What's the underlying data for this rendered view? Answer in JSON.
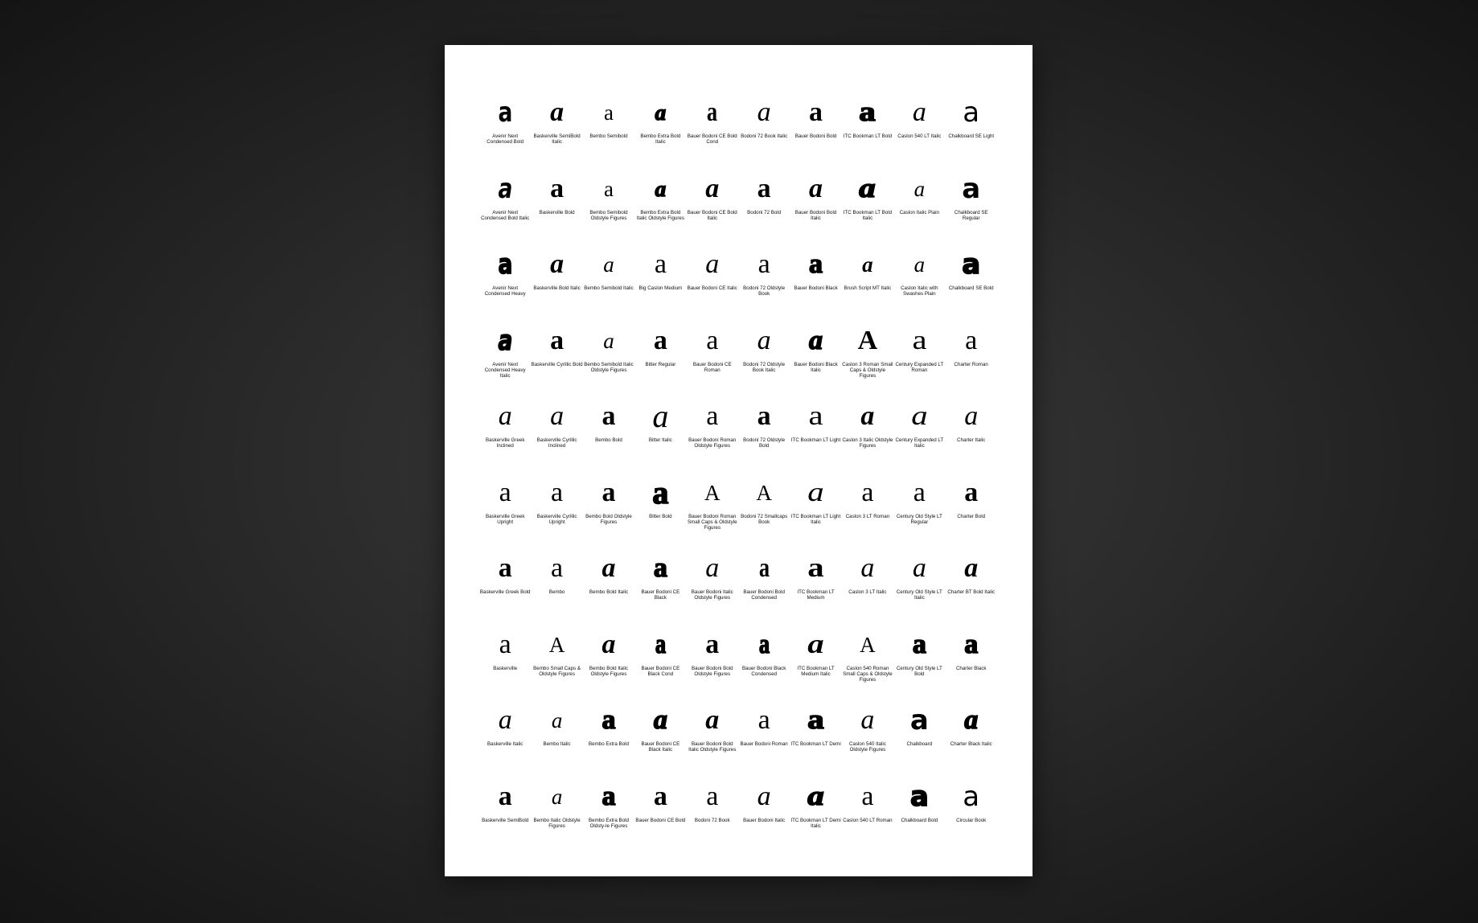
{
  "glyph_char": "a",
  "specimens": [
    {
      "name": "Avenir Next Condensed Bold",
      "glyph": "a",
      "style": "sans b cond"
    },
    {
      "name": "Baskerville SemiBold Italic",
      "glyph": "a",
      "style": "serif b i"
    },
    {
      "name": "Bembo Semibold",
      "glyph": "a",
      "style": "serif small"
    },
    {
      "name": "Bembo Extra Bold Italic",
      "glyph": "a",
      "style": "serif xb i small"
    },
    {
      "name": "Bauer Bodoni CE Bold Cond",
      "glyph": "a",
      "style": "serif b cond"
    },
    {
      "name": "Bodoni 72 Book Italic",
      "glyph": "a",
      "style": "serif i"
    },
    {
      "name": "Bauer Bodoni Bold",
      "glyph": "a",
      "style": "serif b"
    },
    {
      "name": "ITC Bookman LT Bold",
      "glyph": "a",
      "style": "serif xb wide"
    },
    {
      "name": "Caslon 540 LT Italic",
      "glyph": "a",
      "style": "serif i"
    },
    {
      "name": "Chalkboard SE Light",
      "glyph": "a",
      "style": "sans"
    },
    {
      "name": "Avenir Next Condensed Bold Italic",
      "glyph": "a",
      "style": "sans b i cond"
    },
    {
      "name": "Baskerville Bold",
      "glyph": "a",
      "style": "serif b"
    },
    {
      "name": "Bembo Semibold Oldstyle Figures",
      "glyph": "a",
      "style": "serif small"
    },
    {
      "name": "Bembo Extra Bold Italic Oldstyle Figures",
      "glyph": "a",
      "style": "serif xb i small"
    },
    {
      "name": "Bauer Bodoni CE Bold Italic",
      "glyph": "a",
      "style": "serif b i"
    },
    {
      "name": "Bodoni 72 Bold",
      "glyph": "a",
      "style": "serif b"
    },
    {
      "name": "Bauer Bodoni Bold Italic",
      "glyph": "a",
      "style": "serif b i"
    },
    {
      "name": "ITC Bookman LT Bold Italic",
      "glyph": "a",
      "style": "serif xb i wide"
    },
    {
      "name": "Caslon Italic Plain",
      "glyph": "a",
      "style": "serif i small"
    },
    {
      "name": "Chalkboard SE Regular",
      "glyph": "a",
      "style": "sans b"
    },
    {
      "name": "Avenir Next Condensed Heavy",
      "glyph": "a",
      "style": "sans xb cond"
    },
    {
      "name": "Baskerville Bold Italic",
      "glyph": "a",
      "style": "serif b i"
    },
    {
      "name": "Bembo Semibold Italic",
      "glyph": "a",
      "style": "serif i small"
    },
    {
      "name": "Big Caslon Medium",
      "glyph": "a",
      "style": "serif"
    },
    {
      "name": "Bauer Bodoni CE Italic",
      "glyph": "a",
      "style": "serif i"
    },
    {
      "name": "Bodoni 72 Oldstyle Book",
      "glyph": "a",
      "style": "serif"
    },
    {
      "name": "Bauer Bodoni Black",
      "glyph": "a",
      "style": "serif xb"
    },
    {
      "name": "Brush Script MT Italic",
      "glyph": "a",
      "style": "serif b i small"
    },
    {
      "name": "Caslon Italic with Swashes Plain",
      "glyph": "a",
      "style": "serif i small"
    },
    {
      "name": "Chalkboard SE Bold",
      "glyph": "a",
      "style": "sans xb"
    },
    {
      "name": "Avenir Next Condensed Heavy Italic",
      "glyph": "a",
      "style": "sans xb i cond"
    },
    {
      "name": "Baskerville Cyrillic Bold",
      "glyph": "a",
      "style": "serif b"
    },
    {
      "name": "Bembo Semibold Italic Oldstyle Figures",
      "glyph": "a",
      "style": "serif i small"
    },
    {
      "name": "Bitter Regular",
      "glyph": "a",
      "style": "serif b"
    },
    {
      "name": "Bauer Bodoni CE Roman",
      "glyph": "a",
      "style": "serif"
    },
    {
      "name": "Bodoni 72 Oldstyle Book Italic",
      "glyph": "a",
      "style": "serif i"
    },
    {
      "name": "Bauer Bodoni Black Italic",
      "glyph": "a",
      "style": "serif xb i"
    },
    {
      "name": "Caslon 3 Roman Small Caps & Oldstyle Figures",
      "glyph": "A",
      "style": "serif b"
    },
    {
      "name": "Century Expanded LT Roman",
      "glyph": "a",
      "style": "serif wide"
    },
    {
      "name": "Charter Roman",
      "glyph": "a",
      "style": "serif"
    },
    {
      "name": "Baskerville Greek Inclined",
      "glyph": "a",
      "style": "serif i"
    },
    {
      "name": "Baskerville Cyrillic Inclined",
      "glyph": "a",
      "style": "serif i"
    },
    {
      "name": "Bembo Bold",
      "glyph": "a",
      "style": "serif b"
    },
    {
      "name": "Bitter Italic",
      "glyph": "a",
      "style": "serif i big"
    },
    {
      "name": "Bauer Bodoni Roman Oldstyle Figures",
      "glyph": "a",
      "style": "serif"
    },
    {
      "name": "Bodoni 72 Oldstyle Bold",
      "glyph": "a",
      "style": "serif b"
    },
    {
      "name": "ITC Bookman LT Light",
      "glyph": "a",
      "style": "serif wide"
    },
    {
      "name": "Caslon 3 Italic Oldstyle Figures",
      "glyph": "a",
      "style": "serif b i"
    },
    {
      "name": "Century Expanded LT Italic",
      "glyph": "a",
      "style": "serif i wide"
    },
    {
      "name": "Charter Italic",
      "glyph": "a",
      "style": "serif i"
    },
    {
      "name": "Baskerville Greek Upright",
      "glyph": "a",
      "style": "serif"
    },
    {
      "name": "Baskerville Cyrillic Upright",
      "glyph": "a",
      "style": "serif"
    },
    {
      "name": "Bembo Bold Oldstyle Figures",
      "glyph": "a",
      "style": "serif b"
    },
    {
      "name": "Bitter Bold",
      "glyph": "a",
      "style": "serif xb big"
    },
    {
      "name": "Bauer Bodoni Roman Small Caps & Oldstyle Figures",
      "glyph": "A",
      "style": "serif small"
    },
    {
      "name": "Bodoni 72 Smallcaps Book",
      "glyph": "A",
      "style": "serif small"
    },
    {
      "name": "ITC Bookman LT Light Italic",
      "glyph": "a",
      "style": "serif i wide"
    },
    {
      "name": "Caslon 3 LT Roman",
      "glyph": "a",
      "style": "serif"
    },
    {
      "name": "Century Old Style LT Regular",
      "glyph": "a",
      "style": "serif"
    },
    {
      "name": "Charter Bold",
      "glyph": "a",
      "style": "serif b"
    },
    {
      "name": "Baskerville Greek Bold",
      "glyph": "a",
      "style": "serif b"
    },
    {
      "name": "Bembo",
      "glyph": "a",
      "style": "serif"
    },
    {
      "name": "Bembo Bold Italic",
      "glyph": "a",
      "style": "serif b i"
    },
    {
      "name": "Bauer Bodoni CE Black",
      "glyph": "a",
      "style": "serif xb"
    },
    {
      "name": "Bauer Bodoni Italic Oldstyle Figures",
      "glyph": "a",
      "style": "serif i"
    },
    {
      "name": "Bauer Bodoni Bold Condensed",
      "glyph": "a",
      "style": "serif b cond"
    },
    {
      "name": "ITC Bookman LT Medium",
      "glyph": "a",
      "style": "serif b wide"
    },
    {
      "name": "Caslon 3 LT Italic",
      "glyph": "a",
      "style": "serif i"
    },
    {
      "name": "Century Old Style LT Italic",
      "glyph": "a",
      "style": "serif i"
    },
    {
      "name": "Charter BT Bold Italic",
      "glyph": "a",
      "style": "serif b i"
    },
    {
      "name": "Baskerville",
      "glyph": "a",
      "style": "serif"
    },
    {
      "name": "Bembo Small Caps & Oldstyle Figures",
      "glyph": "A",
      "style": "serif small"
    },
    {
      "name": "Bembo Bold Italic Oldstyle Figures",
      "glyph": "a",
      "style": "serif b i"
    },
    {
      "name": "Bauer Bodoni CE Black Cond",
      "glyph": "a",
      "style": "serif xb cond"
    },
    {
      "name": "Bauer Bodoni Bold Oldstyle Figures",
      "glyph": "a",
      "style": "serif b"
    },
    {
      "name": "Bauer Bodoni Black Condensed",
      "glyph": "a",
      "style": "serif xb cond"
    },
    {
      "name": "ITC Bookman LT Medium Italic",
      "glyph": "a",
      "style": "serif b i wide"
    },
    {
      "name": "Caslon 540 Roman Small Caps & Oldstyle Figures",
      "glyph": "A",
      "style": "serif small"
    },
    {
      "name": "Century Old Style LT Bold",
      "glyph": "a",
      "style": "serif xb"
    },
    {
      "name": "Charter Black",
      "glyph": "a",
      "style": "serif xb"
    },
    {
      "name": "Baskerville Italic",
      "glyph": "a",
      "style": "serif i"
    },
    {
      "name": "Bembo Italic",
      "glyph": "a",
      "style": "serif i small"
    },
    {
      "name": "Bembo Extra Bold",
      "glyph": "a",
      "style": "serif xb"
    },
    {
      "name": "Bauer Bodoni CE Black Italic",
      "glyph": "a",
      "style": "serif xb i"
    },
    {
      "name": "Bauer Bodoni Bold Italic Oldstyle Figures",
      "glyph": "a",
      "style": "serif b i"
    },
    {
      "name": "Bauer Bodoni Roman",
      "glyph": "a",
      "style": "serif"
    },
    {
      "name": "ITC Bookman LT Demi",
      "glyph": "a",
      "style": "serif xb wide"
    },
    {
      "name": "Caslon 540 Italic Oldstyle Figures",
      "glyph": "a",
      "style": "serif i"
    },
    {
      "name": "Chalkboard",
      "glyph": "a",
      "style": "sans b"
    },
    {
      "name": "Charter Black Italic",
      "glyph": "a",
      "style": "serif xb i"
    },
    {
      "name": "Baskerville SemiBold",
      "glyph": "a",
      "style": "serif b"
    },
    {
      "name": "Bembo Italic Oldstyle Figures",
      "glyph": "a",
      "style": "serif i small"
    },
    {
      "name": "Bembo Extra Bold Oldsty-le Figures",
      "glyph": "a",
      "style": "serif xb"
    },
    {
      "name": "Bauer Bodoni CE Bold",
      "glyph": "a",
      "style": "serif b"
    },
    {
      "name": "Bodoni 72 Book",
      "glyph": "a",
      "style": "serif"
    },
    {
      "name": "Bauer Bodoni Italic",
      "glyph": "a",
      "style": "serif i"
    },
    {
      "name": "ITC Bookman LT Demi Italic",
      "glyph": "a",
      "style": "serif xb i wide"
    },
    {
      "name": "Caslon 540 LT Roman",
      "glyph": "a",
      "style": "serif"
    },
    {
      "name": "Chalkboard Bold",
      "glyph": "a",
      "style": "sans xb"
    },
    {
      "name": "Circular Book",
      "glyph": "a",
      "style": "sans"
    }
  ]
}
